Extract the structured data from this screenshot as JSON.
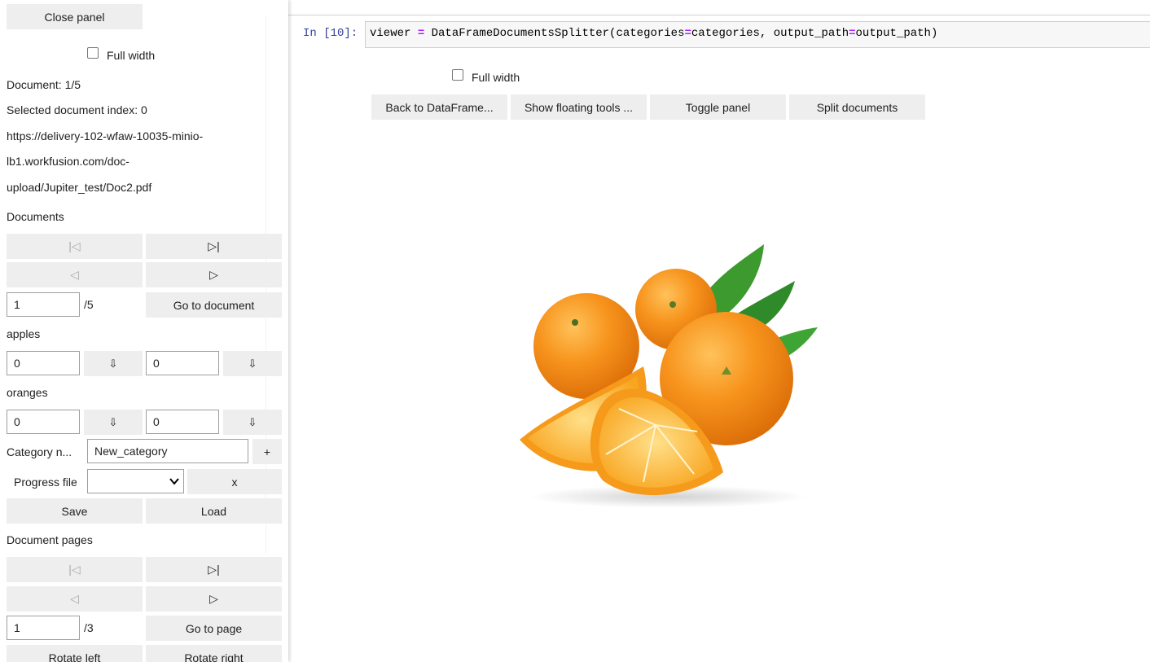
{
  "panel": {
    "close_label": "Close panel",
    "full_width_label": "Full width",
    "document_counter": "Document: 1/5",
    "selected_index": "Selected document index: 0",
    "url_lines": [
      "https://delivery-102-wfaw-10035-minio-",
      "lb1.workfusion.com/doc-",
      "upload/Jupiter_test/Doc2.pdf"
    ],
    "documents_heading": "Documents",
    "nav": {
      "first": "|◁",
      "last": "▷|",
      "prev": "◁",
      "next": "▷"
    },
    "doc_input_value": "1",
    "doc_total": "/5",
    "go_to_document": "Go to document",
    "categories": [
      {
        "name": "apples",
        "start": "0",
        "end": "0",
        "arrow": "⇩"
      },
      {
        "name": "oranges",
        "start": "0",
        "end": "0",
        "arrow": "⇩"
      }
    ],
    "category_name_label": "Category n...",
    "category_name_value": "New_category",
    "add_label": "+",
    "progress_file_label": "Progress file",
    "progress_file_value": "",
    "clear_label": "x",
    "save_label": "Save",
    "load_label": "Load",
    "pages_heading": "Document pages",
    "page_input_value": "1",
    "page_total": "/3",
    "go_to_page": "Go to page",
    "rotate_left": "Rotate left",
    "rotate_right": "Rotate right"
  },
  "notebook": {
    "prompt": "In [10]:",
    "code": {
      "var": "viewer ",
      "eq1": "=",
      "call": " DataFrameDocumentsSplitter(categories",
      "eq2": "=",
      "arg1": "categories, output_path",
      "eq3": "=",
      "arg2": "output_path)"
    },
    "full_width_label": "Full width",
    "buttons": [
      "Back to DataFrame...",
      "Show floating tools ...",
      "Toggle panel",
      "Split documents"
    ]
  },
  "colors": {
    "button_bg": "#eeeeee",
    "prompt_blue": "#303f9f",
    "code_operator": "#aa22ff",
    "orange": "#f28c13",
    "leaf": "#2f8a2a"
  }
}
